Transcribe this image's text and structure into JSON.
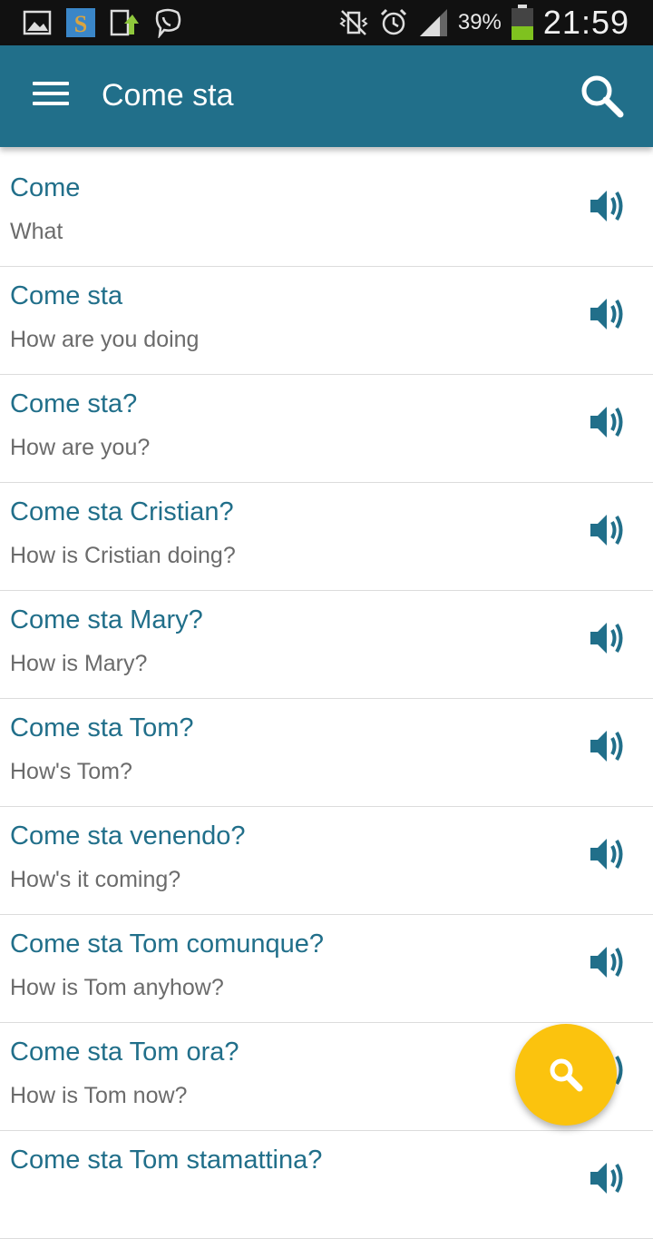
{
  "status_bar": {
    "icons": [
      "image-icon",
      "s-app-icon",
      "upload-icon",
      "viber-icon",
      "vibrate-mute-icon",
      "alarm-icon",
      "signal-icon",
      "battery-icon"
    ],
    "battery": "39%",
    "time": "21:59"
  },
  "app_bar": {
    "title": "Come sta",
    "background": "#216f8a"
  },
  "rows": [
    {
      "title": "Come",
      "subtitle": "What"
    },
    {
      "title": "Come sta",
      "subtitle": "How are you doing"
    },
    {
      "title": "Come sta?",
      "subtitle": "How are you?"
    },
    {
      "title": "Come sta Cristian?",
      "subtitle": "How is Cristian doing?"
    },
    {
      "title": "Come sta Mary?",
      "subtitle": "How is Mary?"
    },
    {
      "title": "Come sta Tom?",
      "subtitle": "How's Tom?"
    },
    {
      "title": "Come sta venendo?",
      "subtitle": "How's it coming?"
    },
    {
      "title": "Come sta Tom comunque?",
      "subtitle": "How is Tom anyhow?"
    },
    {
      "title": "Come sta Tom ora?",
      "subtitle": "How is Tom now?"
    },
    {
      "title": "Come sta Tom stamattina?",
      "subtitle": ""
    }
  ],
  "fab": {
    "icon": "search-icon",
    "color": "#fbc30e"
  }
}
